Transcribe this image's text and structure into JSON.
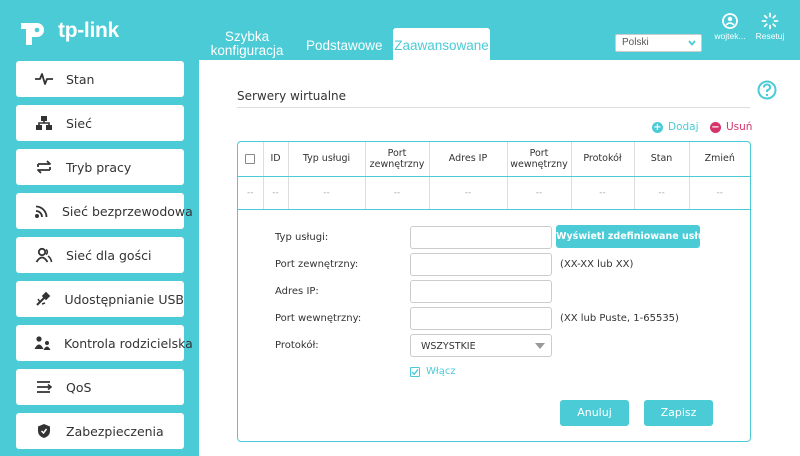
{
  "brand": {
    "logo_text": "tp-link"
  },
  "nav": {
    "tabs": [
      {
        "line1": "Szybka",
        "line2": "konfiguracja"
      },
      {
        "label": "Podstawowe"
      },
      {
        "label": "Zaawansowane"
      }
    ]
  },
  "header": {
    "language": "Polski",
    "user_label": "wojtek...",
    "reset_label": "Resetuj"
  },
  "sidebar": {
    "items": [
      {
        "label": "Stan",
        "icon": "pulse-icon"
      },
      {
        "label": "Sieć",
        "icon": "network-icon"
      },
      {
        "label": "Tryb pracy",
        "icon": "mode-switch-icon"
      },
      {
        "label": "Sieć bezprzewodowa",
        "icon": "wifi-icon"
      },
      {
        "label": "Sieć dla gości",
        "icon": "guests-icon"
      },
      {
        "label": "Udostępnianie USB",
        "icon": "usb-icon"
      },
      {
        "label": "Kontrola rodzicielska",
        "icon": "parental-icon"
      },
      {
        "label": "QoS",
        "icon": "qos-icon"
      },
      {
        "label": "Zabezpieczenia",
        "icon": "shield-icon"
      }
    ]
  },
  "main": {
    "section_title": "Serwery wirtualne",
    "add_label": "Dodaj",
    "delete_label": "Usuń",
    "table": {
      "columns": [
        "ID",
        "Typ usługi",
        "Port zewnętrzny",
        "Adres IP",
        "Port wewnętrzny",
        "Protokół",
        "Stan",
        "Zmień"
      ],
      "empty_row": [
        "--",
        "--",
        "--",
        "--",
        "--",
        "--",
        "--",
        "--",
        "--"
      ]
    },
    "form": {
      "service_type_label": "Typ usługi:",
      "service_type_value": "",
      "show_services_button": "Wyświetl zdefiniowane usługi",
      "external_port_label": "Port zewnętrzny:",
      "external_port_value": "",
      "external_port_hint": "(XX-XX lub XX)",
      "ip_label": "Adres IP:",
      "ip_value": "",
      "internal_port_label": "Port wewnętrzny:",
      "internal_port_value": "",
      "internal_port_hint": "(XX lub Puste, 1-65535)",
      "protocol_label": "Protokół:",
      "protocol_value": "WSZYSTKIE",
      "enable_label": "Włącz",
      "enable_checked": true,
      "cancel_button": "Anuluj",
      "save_button": "Zapisz"
    }
  },
  "colors": {
    "accent": "#4acbd6",
    "add": "#4acbd6",
    "delete": "#d6336c"
  }
}
